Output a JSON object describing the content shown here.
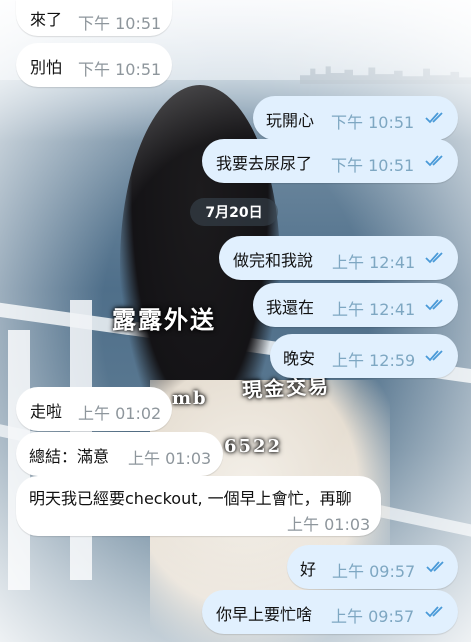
{
  "watermarks": {
    "service": "露露外送",
    "cash": "現金交易",
    "fragment_mb": "mb",
    "fragment_num": "6522"
  },
  "date_divider": "7月20日",
  "messages": [
    {
      "dir": "in",
      "text": "來了",
      "time": "下午 10:51"
    },
    {
      "dir": "in",
      "text": "別怕",
      "time": "下午 10:51"
    },
    {
      "dir": "out",
      "text": "玩開心",
      "time": "下午 10:51",
      "status": "read"
    },
    {
      "dir": "out",
      "text": "我要去尿尿了",
      "time": "下午 10:51",
      "status": "read"
    },
    {
      "dir": "out",
      "text": "做完和我說",
      "time": "上午 12:41",
      "status": "read"
    },
    {
      "dir": "out",
      "text": "我還在",
      "time": "上午 12:41",
      "status": "read"
    },
    {
      "dir": "out",
      "text": "晚安",
      "time": "上午 12:59",
      "status": "read"
    },
    {
      "dir": "in",
      "text": "走啦",
      "time": "上午 01:02"
    },
    {
      "dir": "in",
      "text": "總結：滿意",
      "time": "上午 01:03"
    },
    {
      "dir": "in",
      "text": "明天我已經要checkout, 一個早上會忙，再聊",
      "time": "上午 01:03"
    },
    {
      "dir": "out",
      "text": "好",
      "time": "上午 09:57",
      "status": "read"
    },
    {
      "dir": "out",
      "text": "你早上要忙啥",
      "time": "上午 09:57",
      "status": "read"
    }
  ],
  "colors": {
    "incoming_bubble": "#ffffff",
    "outgoing_bubble": "#e1f0fe",
    "read_check": "#4a9ad8"
  },
  "icons": {
    "read_receipt": "double-check-icon"
  }
}
